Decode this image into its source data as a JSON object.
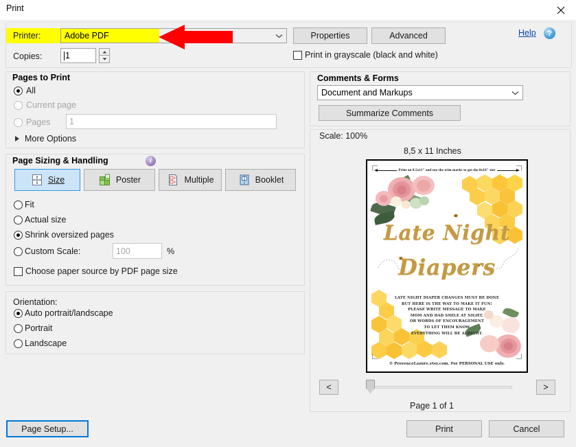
{
  "window": {
    "title": "Print",
    "close_icon": "close-icon"
  },
  "printer": {
    "label": "Printer:",
    "selected": "Adobe PDF",
    "dropdown_icon": "chevron-down-icon",
    "properties_button": "Properties",
    "advanced_button": "Advanced",
    "help_link": "Help",
    "help_icon": "question-mark-icon",
    "highlight_color": "#ffff00",
    "annotation_arrow_color": "#ff0000"
  },
  "copies": {
    "label": "Copies:",
    "value": "1",
    "spinner_up_icon": "caret-up-icon",
    "spinner_down_icon": "caret-down-icon"
  },
  "grayscale": {
    "label": "Print in grayscale (black and white)",
    "checked": false
  },
  "pages_to_print": {
    "header": "Pages to Print",
    "options": [
      {
        "label": "All",
        "selected": true,
        "disabled": false
      },
      {
        "label": "Current page",
        "selected": false,
        "disabled": true
      },
      {
        "label": "Pages",
        "selected": false,
        "disabled": true
      }
    ],
    "pages_value": "1",
    "more_options": "More Options",
    "more_options_icon": "triangle-right-icon"
  },
  "page_sizing": {
    "header": "Page Sizing & Handling",
    "info_icon": "info-icon",
    "modes": [
      {
        "label": "Size",
        "icon": "resize-page-icon",
        "selected": true
      },
      {
        "label": "Poster",
        "icon": "poster-tiles-icon",
        "selected": false
      },
      {
        "label": "Multiple",
        "icon": "multiple-pages-icon",
        "selected": false
      },
      {
        "label": "Booklet",
        "icon": "booklet-icon",
        "selected": false
      }
    ],
    "options": [
      {
        "label": "Fit",
        "selected": false
      },
      {
        "label": "Actual size",
        "selected": false
      },
      {
        "label": "Shrink oversized pages",
        "selected": true
      },
      {
        "label": "Custom Scale:",
        "selected": false
      }
    ],
    "custom_scale_value": "100",
    "percent_sign": "%",
    "paper_source_label": "Choose paper source by PDF page size",
    "paper_source_checked": false
  },
  "orientation": {
    "header": "Orientation:",
    "options": [
      {
        "label": "Auto portrait/landscape",
        "selected": true
      },
      {
        "label": "Portrait",
        "selected": false
      },
      {
        "label": "Landscape",
        "selected": false
      }
    ]
  },
  "comments_forms": {
    "header": "Comments & Forms",
    "selected": "Document and Markups",
    "dropdown_icon": "chevron-down-icon",
    "summarize_button": "Summarize Comments"
  },
  "preview": {
    "scale_text": "Scale: 100%",
    "paper_size_text": "8,5 x 11 Inches",
    "page_indicator": "Page 1 of 1",
    "prev_page_button": "<",
    "next_page_button": ">",
    "document": {
      "trim_note": "Print on 8.5x11\" and use the trim marks to get the 8x10\" size",
      "title_line1": "Late Night",
      "title_line2": "Diapers",
      "poem": [
        "LATE NIGHT DIAPER CHANGES MUST BE DONE",
        "BUT HERE IS THE WAY TO MAKE IT FUN!",
        "PLEASE WRITE MESSAGE TO MAKE",
        "MOM AND DAD SMILE AT NIGHT,",
        "OR WORDS OF ENCOURAGEMENT",
        "TO LET  THEM KNOW",
        "EVERYTHING WILL BE ALRIGHT."
      ],
      "copyright": "© ProvenceLazure.etsy.com. For PERSONAL USE only."
    }
  },
  "footer": {
    "page_setup_button": "Page Setup...",
    "print_button": "Print",
    "cancel_button": "Cancel"
  }
}
